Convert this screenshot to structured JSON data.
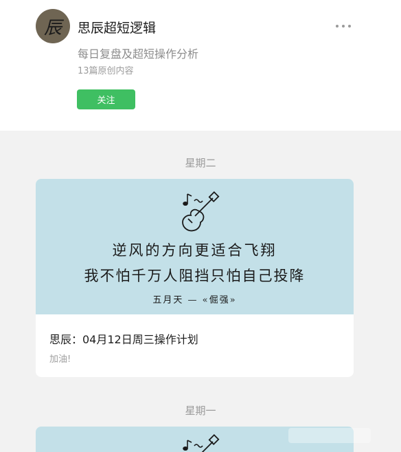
{
  "account": {
    "name": "思辰超短逻辑",
    "bio": "每日复盘及超短操作分析",
    "article_count": "13篇原创内容",
    "follow_label": "关注",
    "avatar_text": "辰"
  },
  "feed": [
    {
      "day": "星期二",
      "cover_lines": [
        "逆风的方向更适合飞翔",
        "我不怕千万人阻挡只怕自己投降",
        "五月天 — «倔强»"
      ],
      "title": "思辰：04月12日周三操作计划",
      "subtitle": "加油!"
    },
    {
      "day": "星期一"
    }
  ],
  "colors": {
    "follow_button": "#3fbf62",
    "cover_background": "#c3e0e8",
    "page_background": "#f2f2f2"
  },
  "icons": [
    "more-icon",
    "guitar-icon",
    "music-note-icon"
  ]
}
